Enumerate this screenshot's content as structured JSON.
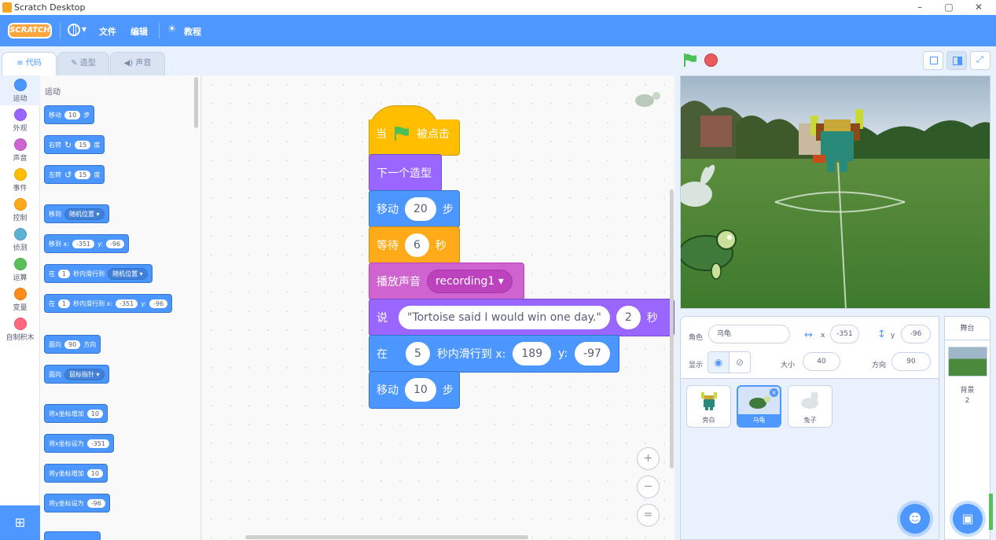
{
  "window": {
    "title": "Scratch Desktop",
    "minimize": "–",
    "maximize": "▢",
    "close": "✕"
  },
  "menu": {
    "logo": "SCRATCH",
    "language_caret": "▾",
    "file": "文件",
    "edit": "编辑",
    "tutorials": "教程"
  },
  "tabs": {
    "code": "代码",
    "costumes": "造型",
    "sounds": "声音"
  },
  "categories": [
    {
      "label": "运动",
      "color": "#4c97ff"
    },
    {
      "label": "外观",
      "color": "#9966ff"
    },
    {
      "label": "声音",
      "color": "#cf63cf"
    },
    {
      "label": "事件",
      "color": "#ffbf00"
    },
    {
      "label": "控制",
      "color": "#ffab19"
    },
    {
      "label": "侦测",
      "color": "#5cb1d6"
    },
    {
      "label": "运算",
      "color": "#59c059"
    },
    {
      "label": "变量",
      "color": "#ff8c1a"
    },
    {
      "label": "自制积木",
      "color": "#ff6680"
    }
  ],
  "palette": {
    "heading": "运动",
    "move": {
      "pre": "移动",
      "val": "10",
      "post": "步"
    },
    "turn_right": {
      "pre": "右转",
      "icon": "↻",
      "val": "15",
      "post": "度"
    },
    "turn_left": {
      "pre": "左转",
      "icon": "↺",
      "val": "15",
      "post": "度"
    },
    "goto": {
      "pre": "移到",
      "dd": "随机位置 ▾"
    },
    "goto_xy": {
      "pre": "移到 x:",
      "x": "-351",
      "mid": "y:",
      "y": "-96"
    },
    "glide_random": {
      "pre": "在",
      "val": "1",
      "mid": "秒内滑行到",
      "dd": "随机位置 ▾"
    },
    "glide_xy": {
      "pre": "在",
      "val": "1",
      "mid": "秒内滑行到 x:",
      "x": "-351",
      "mid2": "y:",
      "y": "-96"
    },
    "point_dir": {
      "pre": "面向",
      "val": "90",
      "post": "方向"
    },
    "point_towards": {
      "pre": "面向",
      "dd": "鼠标指针 ▾"
    },
    "change_x": {
      "pre": "将x坐标增加",
      "val": "10"
    },
    "set_x": {
      "pre": "将x坐标设为",
      "val": "-351"
    },
    "change_y": {
      "pre": "将y坐标增加",
      "val": "10"
    },
    "set_y": {
      "pre": "将y坐标设为",
      "val": "-96"
    }
  },
  "script": {
    "hat": {
      "pre": "当",
      "post": "被点击",
      "color": "#ffbf00"
    },
    "next_costume": {
      "label": "下一个造型",
      "color": "#9966ff"
    },
    "move1": {
      "pre": "移动",
      "val": "20",
      "post": "步"
    },
    "wait": {
      "pre": "等待",
      "val": "6",
      "post": "秒",
      "color": "#ffab19"
    },
    "play_sound": {
      "pre": "播放声音",
      "dd": "recording1 ▾",
      "color": "#cf63cf"
    },
    "say": {
      "pre": "说",
      "msg": "\"Tortoise said I would win one day.\"",
      "secs": "2",
      "post": "秒"
    },
    "glide": {
      "pre": "在",
      "val": "5",
      "mid": "秒内滑行到 x:",
      "x": "189",
      "mid2": "y:",
      "y": "-97"
    },
    "move2": {
      "pre": "移动",
      "val": "10",
      "post": "步"
    }
  },
  "zoom": {
    "in": "+",
    "out": "−",
    "reset": "="
  },
  "sprite_info": {
    "sprite_label": "角色",
    "sprite_name": "乌龟",
    "x_label": "x",
    "x": "-351",
    "y_label": "y",
    "y": "-96",
    "show_label": "显示",
    "size_label": "大小",
    "size": "40",
    "direction_label": "方向",
    "direction": "90"
  },
  "sprites": [
    {
      "name": "旁白"
    },
    {
      "name": "乌龟"
    },
    {
      "name": "兔子"
    }
  ],
  "stage_panel": {
    "title": "舞台",
    "backdrop_label": "背景",
    "backdrop_count": "2"
  }
}
